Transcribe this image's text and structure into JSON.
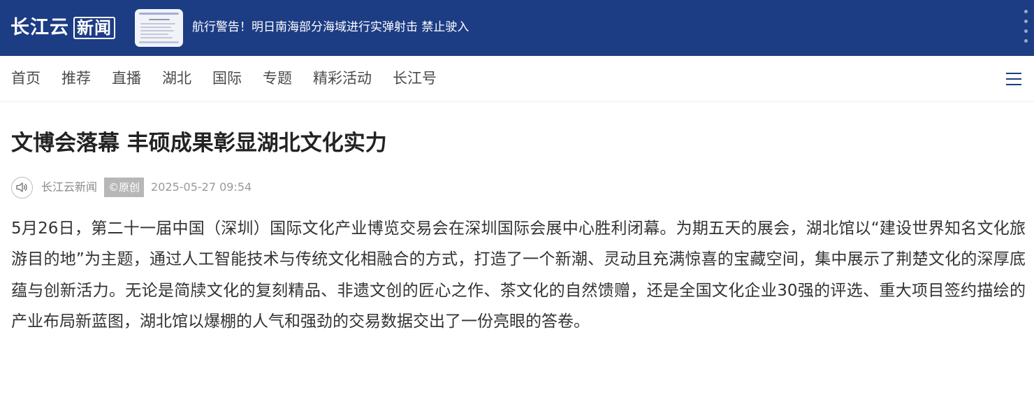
{
  "header": {
    "logo_text": "长江云",
    "logo_badge": "新闻",
    "alert_text": "航行警告！明日南海部分海域进行实弹射击 禁止驶入",
    "thumbnail_icon": "news-thumbnail",
    "more_icon": "vertical-dots-icon",
    "bg_color": "#1c3c84"
  },
  "nav": {
    "items": [
      "首页",
      "推荐",
      "直播",
      "湖北",
      "国际",
      "专题",
      "精彩活动",
      "长江号"
    ],
    "menu_icon": "hamburger-menu-icon"
  },
  "article": {
    "title": "文博会落幕 丰硕成果彰显湖北文化实力",
    "audio_icon": "speaker-icon",
    "source": "长江云新闻",
    "badge": "©原创",
    "date": "2025-05-27 09:54",
    "body": "5月26日，第二十一届中国（深圳）国际文化产业博览交易会在深圳国际会展中心胜利闭幕。为期五天的展会，湖北馆以“建设世界知名文化旅游目的地”为主题，通过人工智能技术与传统文化相融合的方式，打造了一个新潮、灵动且充满惊喜的宝藏空间，集中展示了荆楚文化的深厚底蕴与创新活力。无论是简牍文化的复刻精品、非遗文创的匠心之作、茶文化的自然馈赠，还是全国文化企业30强的评选、重大项目签约描绘的产业布局新蓝图，湖北馆以爆棚的人气和强劲的交易数据交出了一份亮眼的答卷。"
  }
}
